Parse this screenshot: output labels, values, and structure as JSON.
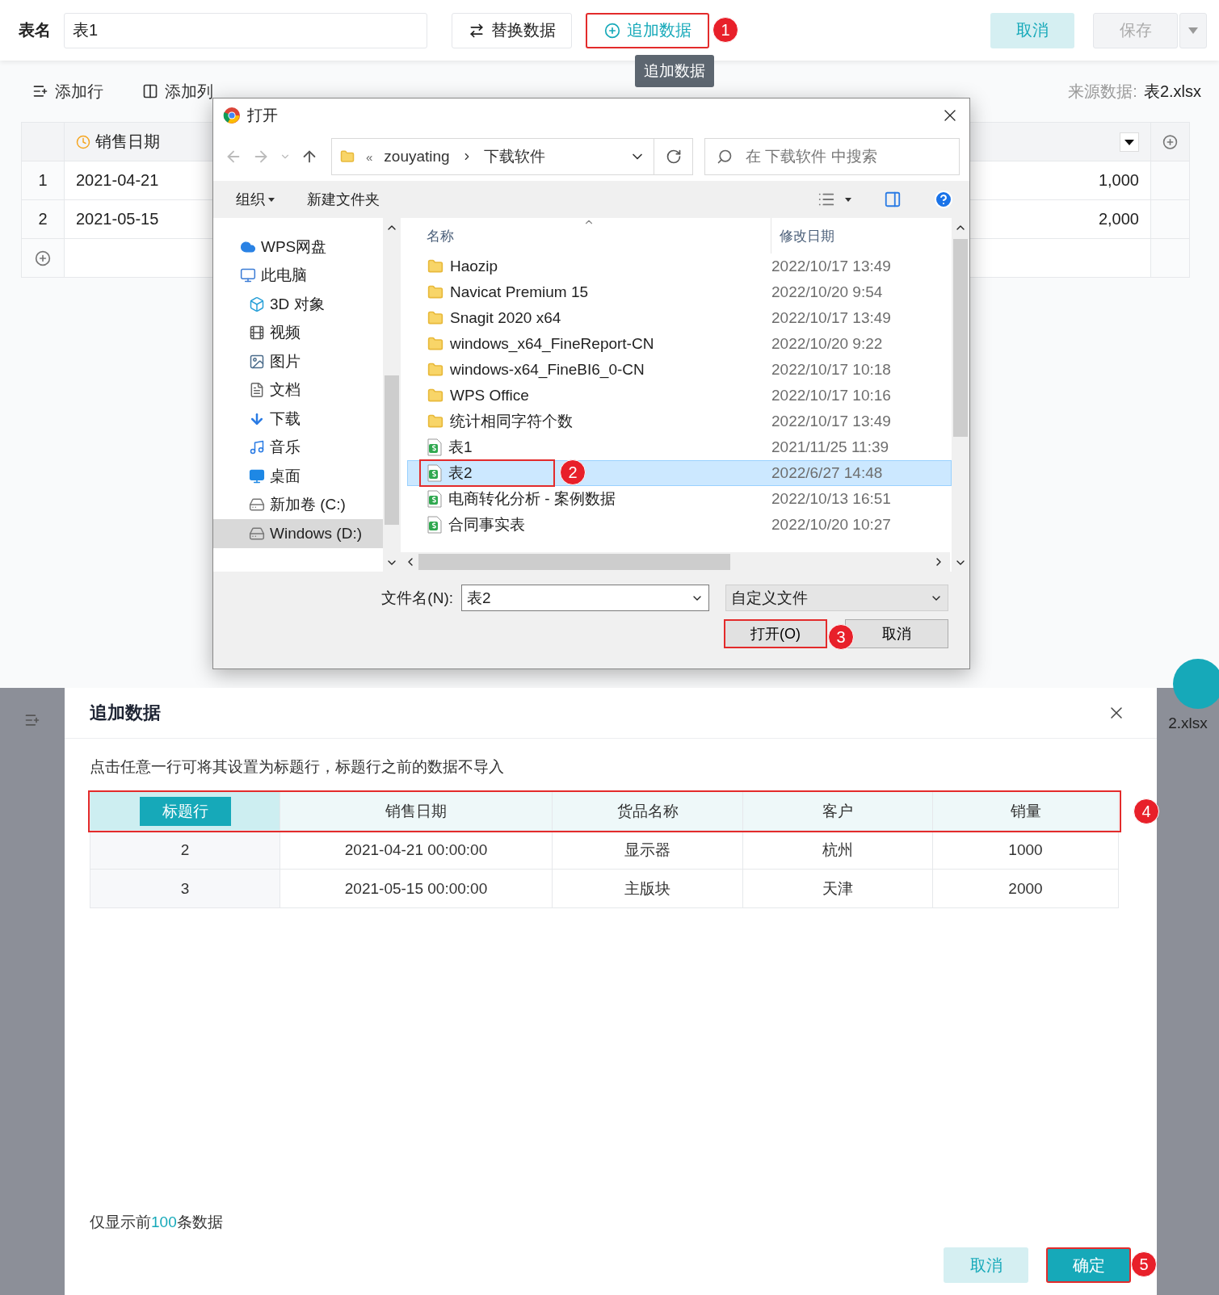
{
  "header": {
    "name_label": "表名",
    "name_value": "表1",
    "replace_button": "替换数据",
    "append_button": {
      "label": "追加数据",
      "callout": "1"
    },
    "tooltip": "追加数据",
    "cancel_button": "取消",
    "save_button": {
      "label": "保存",
      "disabled": true
    }
  },
  "toolbar": {
    "add_row": "添加行",
    "add_column": "添加列",
    "source_label": "来源数据:",
    "source_file": "表2.xlsx"
  },
  "grid": {
    "date_header": "销售日期",
    "rows": [
      {
        "index": "1",
        "date": "2021-04-21",
        "amount": "1,000"
      },
      {
        "index": "2",
        "date": "2021-05-15",
        "amount": "2,000"
      }
    ]
  },
  "file_dialog": {
    "title": "打开",
    "path_overflow": "«",
    "path": [
      "zouyating",
      "下载软件"
    ],
    "search_placeholder": "在 下载软件 中搜索",
    "organize": "组织",
    "new_folder": "新建文件夹",
    "nav": [
      {
        "label": "WPS网盘",
        "kind": "cloud",
        "selected": false
      },
      {
        "label": "此电脑",
        "kind": "pc",
        "selected": false,
        "children": [
          {
            "label": "3D 对象",
            "kind": "cube",
            "selected": false
          },
          {
            "label": "视频",
            "kind": "film",
            "selected": false
          },
          {
            "label": "图片",
            "kind": "image",
            "selected": false
          },
          {
            "label": "文档",
            "kind": "doc",
            "selected": false
          },
          {
            "label": "下载",
            "kind": "download",
            "selected": false
          },
          {
            "label": "音乐",
            "kind": "music",
            "selected": false
          },
          {
            "label": "桌面",
            "kind": "desktop",
            "selected": false
          },
          {
            "label": "新加卷 (C:)",
            "kind": "drive",
            "selected": false
          },
          {
            "label": "Windows (D:)",
            "kind": "drive",
            "selected": true
          }
        ]
      }
    ],
    "columns": [
      "名称",
      "修改日期"
    ],
    "files": [
      {
        "name": "Haozip",
        "modified": "2022/10/17 13:49",
        "kind": "folder",
        "selected": false
      },
      {
        "name": "Navicat Premium 15",
        "modified": "2022/10/20 9:54",
        "kind": "folder",
        "selected": false
      },
      {
        "name": "Snagit 2020 x64",
        "modified": "2022/10/17 13:49",
        "kind": "folder",
        "selected": false
      },
      {
        "name": "windows_x64_FineReport-CN",
        "modified": "2022/10/20 9:22",
        "kind": "folder",
        "selected": false
      },
      {
        "name": "windows-x64_FineBI6_0-CN",
        "modified": "2022/10/17 10:18",
        "kind": "folder",
        "selected": false
      },
      {
        "name": "WPS Office",
        "modified": "2022/10/17 10:16",
        "kind": "folder",
        "selected": false
      },
      {
        "name": "统计相同字符个数",
        "modified": "2022/10/17 13:49",
        "kind": "folder",
        "selected": false
      },
      {
        "name": "表1",
        "modified": "2021/11/25 11:39",
        "kind": "sheet",
        "selected": false
      },
      {
        "name": "表2",
        "modified": "2022/6/27 14:48",
        "kind": "sheet",
        "selected": true,
        "callout": "2"
      },
      {
        "name": "电商转化分析 - 案例数据",
        "modified": "2022/10/13 16:51",
        "kind": "sheet",
        "selected": false
      },
      {
        "name": "合同事实表",
        "modified": "2022/10/20 10:27",
        "kind": "sheet",
        "selected": false
      }
    ],
    "file_name_label": "文件名(N):",
    "file_name": "表2",
    "file_type": "自定义文件",
    "open_button": {
      "label": "打开(O)",
      "callout": "3"
    },
    "cancel_button": "取消"
  },
  "backdrop": {
    "source_file_tail": "2.xlsx"
  },
  "append_dialog": {
    "title": "追加数据",
    "hint": "点击任意一行可将其设置为标题行，标题行之前的数据不导入",
    "header_row": {
      "marker": "标题行",
      "cells": [
        "销售日期",
        "货品名称",
        "客户",
        "销量"
      ],
      "callout": "4"
    },
    "rows": [
      {
        "index": "2",
        "cells": [
          "2021-04-21 00:00:00",
          "显示器",
          "杭州",
          "1000"
        ]
      },
      {
        "index": "3",
        "cells": [
          "2021-05-15 00:00:00",
          "主版块",
          "天津",
          "2000"
        ]
      }
    ],
    "note": {
      "before": "仅显示前",
      "count": "100",
      "after": "条数据"
    },
    "cancel_button": "取消",
    "confirm_button": {
      "label": "确定",
      "callout": "5"
    }
  }
}
